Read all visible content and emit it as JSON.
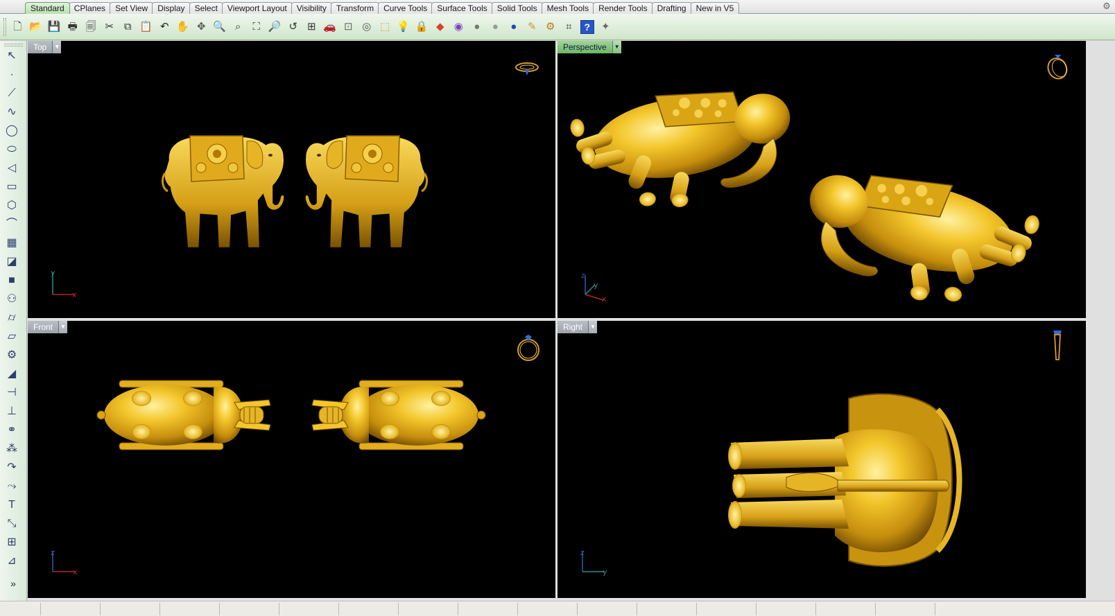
{
  "tabs": [
    {
      "label": "Standard",
      "active": true
    },
    {
      "label": "CPlanes"
    },
    {
      "label": "Set View"
    },
    {
      "label": "Display"
    },
    {
      "label": "Select"
    },
    {
      "label": "Viewport Layout"
    },
    {
      "label": "Visibility"
    },
    {
      "label": "Transform"
    },
    {
      "label": "Curve Tools"
    },
    {
      "label": "Surface Tools"
    },
    {
      "label": "Solid Tools"
    },
    {
      "label": "Mesh Tools"
    },
    {
      "label": "Render Tools"
    },
    {
      "label": "Drafting"
    },
    {
      "label": "New in V5"
    }
  ],
  "toolbar": {
    "buttons": [
      {
        "icon": "new-file-icon",
        "glyph": "🗋",
        "color": "#444444"
      },
      {
        "icon": "open-folder-icon",
        "glyph": "📂",
        "color": "#c89a2a"
      },
      {
        "icon": "save-icon",
        "glyph": "💾",
        "color": "#2a3f7a"
      },
      {
        "icon": "print-icon",
        "glyph": "🖶",
        "color": "#333333"
      },
      {
        "icon": "page-layout-icon",
        "glyph": "🗐",
        "color": "#444444"
      },
      {
        "icon": "cut-icon",
        "glyph": "✂",
        "color": "#333333"
      },
      {
        "icon": "copy-icon",
        "glyph": "⧉",
        "color": "#333333"
      },
      {
        "icon": "paste-icon",
        "glyph": "📋",
        "color": "#b08020"
      },
      {
        "icon": "undo-icon",
        "glyph": "↶",
        "color": "#222222"
      },
      {
        "icon": "pan-hand-icon",
        "glyph": "✋",
        "color": "#555555"
      },
      {
        "icon": "rotate-view-icon",
        "glyph": "✥",
        "color": "#555555"
      },
      {
        "icon": "zoom-icon",
        "glyph": "🔍",
        "color": "#333333"
      },
      {
        "icon": "zoom-window-icon",
        "glyph": "⌕",
        "color": "#333333"
      },
      {
        "icon": "zoom-extents-icon",
        "glyph": "⛶",
        "color": "#333333"
      },
      {
        "icon": "zoom-selected-icon",
        "glyph": "🔎",
        "color": "#333333"
      },
      {
        "icon": "undo-view-change-icon",
        "glyph": "↺",
        "color": "#333333"
      },
      {
        "icon": "four-viewports-icon",
        "glyph": "⊞",
        "color": "#333333"
      },
      {
        "icon": "named-views-car-icon",
        "glyph": "🚗",
        "color": "#c0282a"
      },
      {
        "icon": "named-cplanes-icon",
        "glyph": "⊡",
        "color": "#666666"
      },
      {
        "icon": "osnap-icon",
        "glyph": "◎",
        "color": "#555555"
      },
      {
        "icon": "select-objects-icon",
        "glyph": "⬚",
        "color": "#c89a2a"
      },
      {
        "icon": "lights-bulb-icon",
        "glyph": "💡",
        "color": "#999999"
      },
      {
        "icon": "lock-icon",
        "glyph": "🔒",
        "color": "#444444"
      },
      {
        "icon": "layer-icon",
        "glyph": "◆",
        "color": "#d8412a"
      },
      {
        "icon": "color-wheel-icon",
        "glyph": "◉",
        "color": "#7a3fc0"
      },
      {
        "icon": "shaded-sphere-icon",
        "glyph": "●",
        "color": "#777777"
      },
      {
        "icon": "rendered-sphere-icon",
        "glyph": "●",
        "color": "#999999"
      },
      {
        "icon": "render-sphere-icon",
        "glyph": "●",
        "color": "#1f48b8"
      },
      {
        "icon": "properties-icon",
        "glyph": "✎",
        "color": "#c89a2a"
      },
      {
        "icon": "options-gear-icon",
        "glyph": "⚙",
        "color": "#b08020"
      },
      {
        "icon": "snap-grid-icon",
        "glyph": "⌗",
        "color": "#333333"
      },
      {
        "icon": "help-icon",
        "glyph": "?",
        "color": "#ffffff",
        "help": true
      },
      {
        "icon": "tip-icon",
        "glyph": "✦",
        "color": "#666666"
      }
    ]
  },
  "left_toolbar": {
    "buttons": [
      {
        "icon": "select-arrow-icon",
        "glyph": "↖"
      },
      {
        "icon": "point-icon",
        "glyph": "·"
      },
      {
        "icon": "polyline-icon",
        "glyph": "⟋"
      },
      {
        "icon": "curve-icon",
        "glyph": "∿"
      },
      {
        "icon": "circle-icon",
        "glyph": "◯"
      },
      {
        "icon": "ellipse-icon",
        "glyph": "⬭"
      },
      {
        "icon": "polygon-arc-icon",
        "glyph": "◁"
      },
      {
        "icon": "rectangle-icon",
        "glyph": "▭"
      },
      {
        "icon": "polygon-icon",
        "glyph": "⬡"
      },
      {
        "icon": "curve-fillet-icon",
        "glyph": "⌒"
      },
      {
        "icon": "surface-points-icon",
        "glyph": "▦"
      },
      {
        "icon": "extrude-surface-icon",
        "glyph": "◪"
      },
      {
        "icon": "box-solid-icon",
        "glyph": "■"
      },
      {
        "icon": "boolean-spheres-icon",
        "glyph": "⚇"
      },
      {
        "icon": "cylinder-icon",
        "glyph": "⌭"
      },
      {
        "icon": "mesh-plane-icon",
        "glyph": "▱"
      },
      {
        "icon": "render-settings-gear-icon",
        "glyph": "⚙"
      },
      {
        "icon": "dimension-icon",
        "glyph": "◢"
      },
      {
        "icon": "trim-icon",
        "glyph": "⊣"
      },
      {
        "icon": "split-icon",
        "glyph": "⊥"
      },
      {
        "icon": "boolean-union-icon",
        "glyph": "⚭"
      },
      {
        "icon": "array-icon",
        "glyph": "⁂"
      },
      {
        "icon": "fillet-edge-icon",
        "glyph": "↷"
      },
      {
        "icon": "blend-curve-icon",
        "glyph": "⤳"
      },
      {
        "icon": "text-icon",
        "glyph": "T"
      },
      {
        "icon": "scale-icon",
        "glyph": "⤡"
      },
      {
        "icon": "group-icon",
        "glyph": "⊞"
      },
      {
        "icon": "analyze-icon",
        "glyph": "⊿"
      }
    ],
    "more_label": "»"
  },
  "viewports": {
    "top": {
      "title": "Top",
      "axis_h": "x",
      "axis_v": "y"
    },
    "perspective": {
      "title": "Perspective",
      "active": true,
      "axis_1": "z",
      "axis_2": "y",
      "axis_3": "x"
    },
    "front": {
      "title": "Front",
      "axis_h": "x",
      "axis_v": "z"
    },
    "right": {
      "title": "Right",
      "axis_h": "y",
      "axis_v": "z"
    }
  },
  "colors": {
    "viewport_bg": "#000000",
    "gold_light": "#f6cf35",
    "gold_mid": "#d9a514",
    "gold_dark": "#7a5203",
    "axis_red": "#b4282a",
    "axis_green": "#2f8c86",
    "axis_blue": "#2a60a8",
    "ring_gold": "#d89a2a",
    "ring_gem": "#2f6ad8"
  }
}
